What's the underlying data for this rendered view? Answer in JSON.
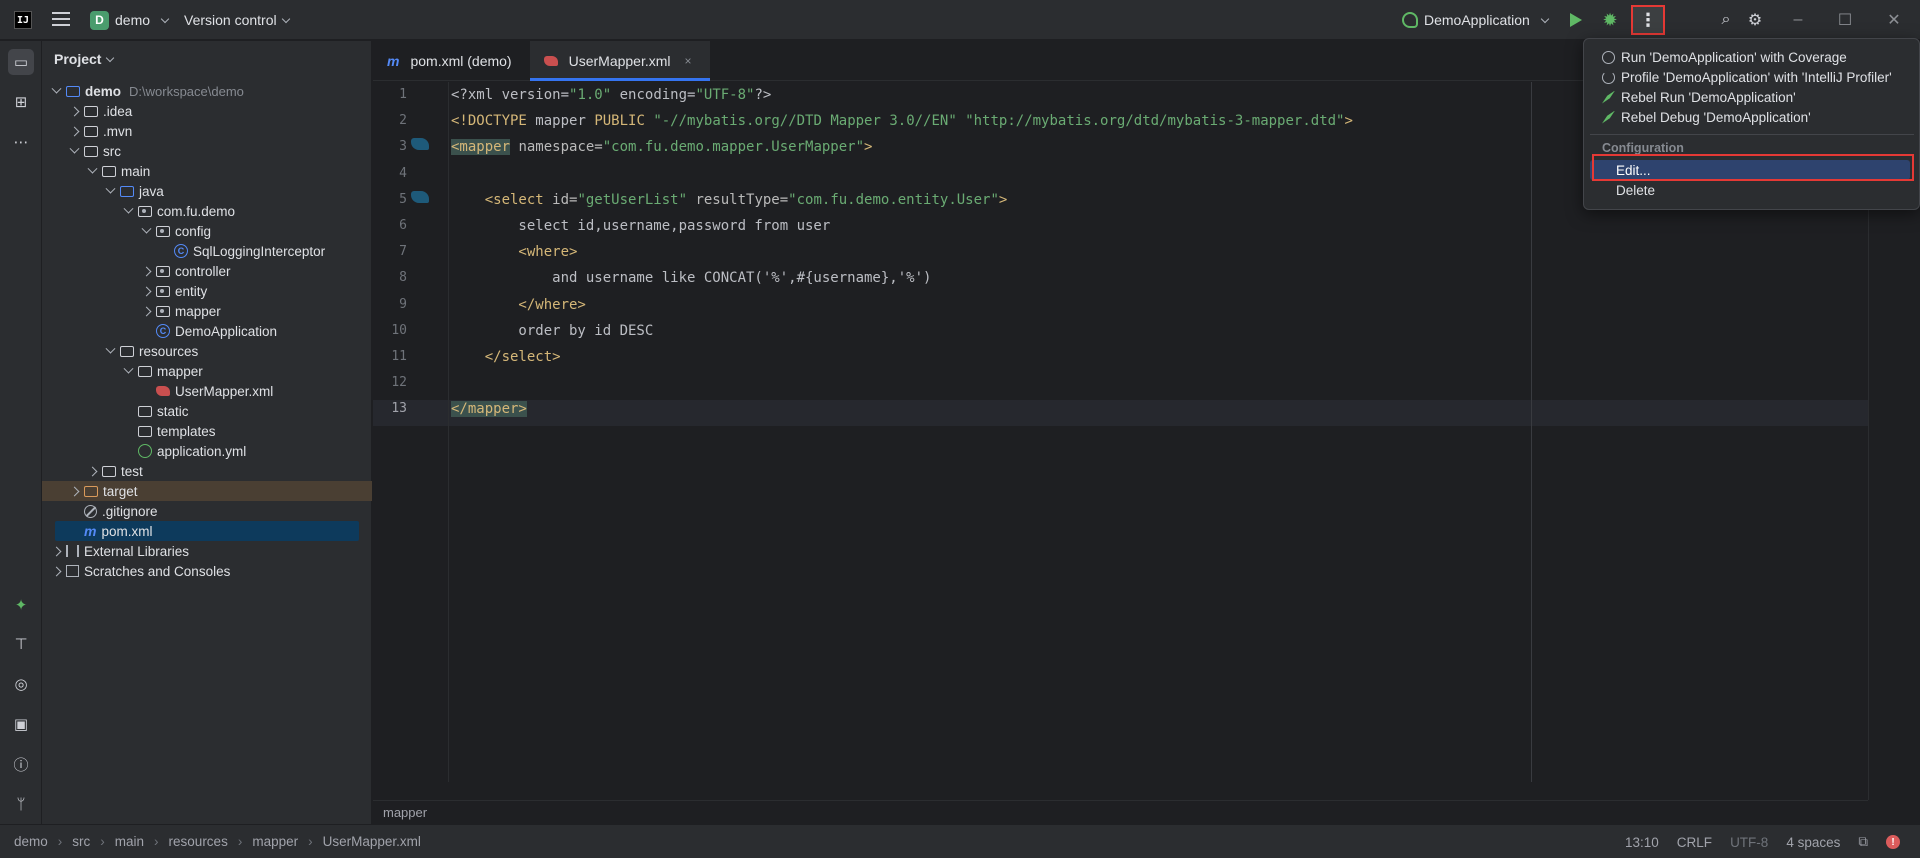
{
  "titlebar": {
    "logo": "IJ",
    "project_badge": "D",
    "project_name": "demo",
    "version_control": "Version control",
    "run_config": "DemoApplication"
  },
  "project_panel": {
    "title": "Project",
    "tree": [
      {
        "label": "demo",
        "hint": "D:\\workspace\\demo",
        "indent": 0,
        "arrow": "down",
        "icon": "folder-blue",
        "bold": true
      },
      {
        "label": ".idea",
        "indent": 1,
        "arrow": "right",
        "icon": "folder"
      },
      {
        "label": ".mvn",
        "indent": 1,
        "arrow": "right",
        "icon": "folder"
      },
      {
        "label": "src",
        "indent": 1,
        "arrow": "down",
        "icon": "folder"
      },
      {
        "label": "main",
        "indent": 2,
        "arrow": "down",
        "icon": "folder"
      },
      {
        "label": "java",
        "indent": 3,
        "arrow": "down",
        "icon": "folder-blue"
      },
      {
        "label": "com.fu.demo",
        "indent": 4,
        "arrow": "down",
        "icon": "package"
      },
      {
        "label": "config",
        "indent": 5,
        "arrow": "down",
        "icon": "package"
      },
      {
        "label": "SqlLoggingInterceptor",
        "indent": 6,
        "arrow": "none",
        "icon": "class"
      },
      {
        "label": "controller",
        "indent": 5,
        "arrow": "right",
        "icon": "package"
      },
      {
        "label": "entity",
        "indent": 5,
        "arrow": "right",
        "icon": "package"
      },
      {
        "label": "mapper",
        "indent": 5,
        "arrow": "right",
        "icon": "package"
      },
      {
        "label": "DemoApplication",
        "indent": 5,
        "arrow": "none",
        "icon": "class"
      },
      {
        "label": "resources",
        "indent": 3,
        "arrow": "down",
        "icon": "folder"
      },
      {
        "label": "mapper",
        "indent": 4,
        "arrow": "down",
        "icon": "folder"
      },
      {
        "label": "UserMapper.xml",
        "indent": 5,
        "arrow": "none",
        "icon": "xml"
      },
      {
        "label": "static",
        "indent": 4,
        "arrow": "none",
        "icon": "folder"
      },
      {
        "label": "templates",
        "indent": 4,
        "arrow": "none",
        "icon": "folder"
      },
      {
        "label": "application.yml",
        "indent": 4,
        "arrow": "none",
        "icon": "yml"
      },
      {
        "label": "test",
        "indent": 2,
        "arrow": "right",
        "icon": "folder"
      },
      {
        "label": "target",
        "indent": 1,
        "arrow": "right",
        "icon": "folder-orange",
        "highlight": "target"
      },
      {
        "label": ".gitignore",
        "indent": 1,
        "arrow": "none",
        "icon": "ignore"
      },
      {
        "label": "pom.xml",
        "indent": 1,
        "arrow": "none",
        "icon": "maven",
        "highlight": "pom"
      },
      {
        "label": "External Libraries",
        "indent": 0,
        "arrow": "right",
        "icon": "library"
      },
      {
        "label": "Scratches and Consoles",
        "indent": 0,
        "arrow": "right",
        "icon": "scratch"
      }
    ]
  },
  "tabs": [
    {
      "icon_text": "m",
      "label": "pom.xml (demo)",
      "active": false
    },
    {
      "label": "UserMapper.xml",
      "active": true,
      "close": "×"
    }
  ],
  "editor": {
    "line_numbers": [
      "1",
      "2",
      "3",
      "4",
      "5",
      "6",
      "7",
      "8",
      "9",
      "10",
      "11",
      "12",
      "13"
    ],
    "current_line": 13,
    "lines": [
      [
        {
          "t": "<?xml version=",
          "c": "txt"
        },
        {
          "t": "\"1.0\"",
          "c": "str"
        },
        {
          "t": " encoding=",
          "c": "txt"
        },
        {
          "t": "\"UTF-8\"",
          "c": "str"
        },
        {
          "t": "?>",
          "c": "txt"
        }
      ],
      [
        {
          "t": "<!DOCTYPE ",
          "c": "tag"
        },
        {
          "t": "mapper ",
          "c": "txt"
        },
        {
          "t": "PUBLIC ",
          "c": "tag"
        },
        {
          "t": "\"-//mybatis.org//DTD Mapper 3.0//EN\" \"http://mybatis.org/dtd/mybatis-3-mapper.dtd\"",
          "c": "str"
        },
        {
          "t": ">",
          "c": "tag"
        }
      ],
      [
        {
          "t": "<mapper",
          "c": "taghl"
        },
        {
          "t": " namespace=",
          "c": "attr"
        },
        {
          "t": "\"com.fu.demo.mapper.UserMapper\"",
          "c": "str"
        },
        {
          "t": ">",
          "c": "tag"
        }
      ],
      [],
      [
        {
          "t": "    <select",
          "c": "tag"
        },
        {
          "t": " id=",
          "c": "attr"
        },
        {
          "t": "\"getUserList\"",
          "c": "str"
        },
        {
          "t": " resultType=",
          "c": "attr"
        },
        {
          "t": "\"com.fu.demo.entity.User\"",
          "c": "str"
        },
        {
          "t": ">",
          "c": "tag"
        }
      ],
      [
        {
          "t": "        select id,username,password from user",
          "c": "txt"
        }
      ],
      [
        {
          "t": "        <where>",
          "c": "tag"
        }
      ],
      [
        {
          "t": "            and username like CONCAT('%',#{username},'%')",
          "c": "txt"
        }
      ],
      [
        {
          "t": "        </where>",
          "c": "tag"
        }
      ],
      [
        {
          "t": "        order by id DESC",
          "c": "txt"
        }
      ],
      [
        {
          "t": "    </select>",
          "c": "tag"
        }
      ],
      [],
      [
        {
          "t": "</mapper>",
          "c": "taghl"
        }
      ]
    ],
    "bottom_crumb": "mapper"
  },
  "menu": {
    "items": [
      {
        "label": "Run 'DemoApplication' with Coverage",
        "icon": "coverage"
      },
      {
        "label": "Profile 'DemoApplication' with 'IntelliJ Profiler'",
        "icon": "profiler"
      },
      {
        "label": "Rebel Run 'DemoApplication'",
        "icon": "rebel"
      },
      {
        "label": "Rebel Debug 'DemoApplication'",
        "icon": "rebel"
      }
    ],
    "section_header": "Configuration",
    "edit": "Edit...",
    "delete": "Delete"
  },
  "statusbar": {
    "breadcrumbs": [
      "demo",
      "src",
      "main",
      "resources",
      "mapper",
      "UserMapper.xml"
    ],
    "position": "13:10",
    "line_sep": "CRLF",
    "encoding": "UTF-8",
    "indent": "4 spaces",
    "error_badge": "!"
  },
  "colors": {
    "bg": "#1e1f22",
    "panel": "#2b2d30",
    "accent": "#3574f0",
    "highlight_box": "#e53935",
    "xml_tag": "#d5b778",
    "xml_string": "#6aab73"
  }
}
